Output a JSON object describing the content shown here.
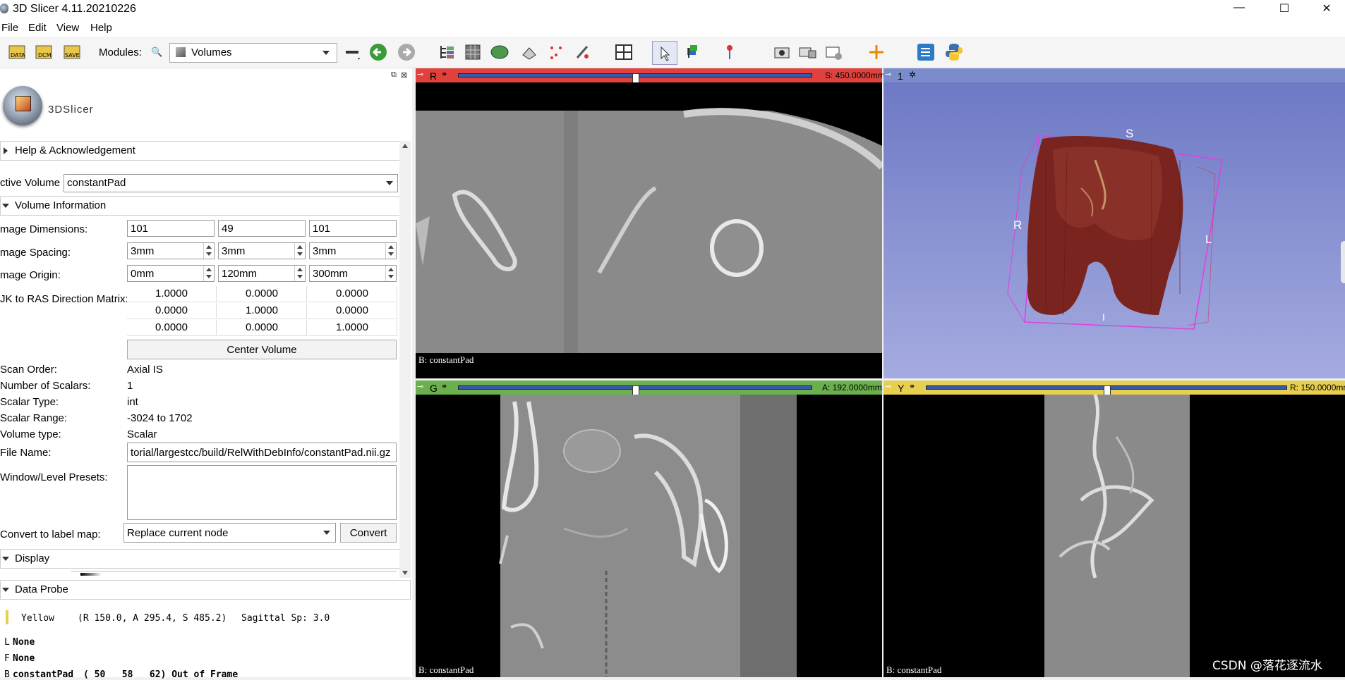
{
  "window": {
    "title": "3D Slicer 4.11.20210226",
    "minimize": "—",
    "maximize": "☐",
    "close": "✕"
  },
  "menu": [
    "File",
    "Edit",
    "View",
    "Help"
  ],
  "toolbar": {
    "modules_label": "Modules:",
    "module_selected": "Volumes",
    "data_label": "DATA",
    "dcm_label": "DCM",
    "save_label": "SAVE"
  },
  "logo_text": "3DSlicer",
  "help_section": "Help & Acknowledgement",
  "active_volume": {
    "label": "ctive Volume",
    "value": "constantPad"
  },
  "volume_info": {
    "title": "Volume Information",
    "dimensions": {
      "label": "mage Dimensions:",
      "values": [
        "101",
        "49",
        "101"
      ]
    },
    "spacing": {
      "label": "mage Spacing:",
      "values": [
        "3mm",
        "3mm",
        "3mm"
      ]
    },
    "origin": {
      "label": "mage Origin:",
      "values": [
        "0mm",
        "120mm",
        "300mm"
      ]
    },
    "matrix": {
      "label": "JK to RAS Direction Matrix:",
      "rows": [
        [
          "1.0000",
          "0.0000",
          "0.0000"
        ],
        [
          "0.0000",
          "1.0000",
          "0.0000"
        ],
        [
          "0.0000",
          "0.0000",
          "1.0000"
        ]
      ]
    },
    "center_button": "Center Volume",
    "scan_order": {
      "label": "Scan Order:",
      "value": "Axial IS"
    },
    "num_scalars": {
      "label": "Number of Scalars:",
      "value": "1"
    },
    "scalar_type": {
      "label": "Scalar Type:",
      "value": "int"
    },
    "scalar_range": {
      "label": "Scalar Range:",
      "value": "-3024 to 1702"
    },
    "volume_type": {
      "label": "Volume type:",
      "value": "Scalar"
    },
    "file_name": {
      "label": "File Name:",
      "value": "torial/largestcc/build/RelWithDebInfo/constantPad.nii.gz"
    },
    "wl_presets": {
      "label": "Window/Level Presets:"
    },
    "convert": {
      "label": "Convert to label map:",
      "option": "Replace current node",
      "button": "Convert"
    }
  },
  "display_section": "Display",
  "data_probe": {
    "title": "Data Probe",
    "view": "Yellow",
    "coords": "(R 150.0, A 295.4, S 485.2)",
    "orientation": "Sagittal Sp: 3.0",
    "rows": [
      {
        "key": "L",
        "value": "None",
        "extra": ""
      },
      {
        "key": "F",
        "value": "None",
        "extra": ""
      },
      {
        "key": "B",
        "value": "constantPad",
        "extra": "( 50   58   62) Out of Frame"
      }
    ]
  },
  "views": {
    "red": {
      "letter": "R",
      "offset": "S: 450.0000mm",
      "level": 0.5,
      "bg_label": "B: constantPad",
      "color": "#e0413c"
    },
    "threed": {
      "number": "1",
      "color": "#7a8ccc",
      "orient_s": "S",
      "orient_r": "R",
      "orient_l": "L",
      "orient_i": "I"
    },
    "green": {
      "letter": "G",
      "offset": "A: 192.0000mm",
      "level": 0.5,
      "bg_label": "B: constantPad",
      "color": "#6ab04c"
    },
    "yellow": {
      "letter": "Y",
      "offset": "R: 150.0000mm",
      "level": 0.5,
      "bg_label": "B: constantPad",
      "color": "#e7cf4f"
    }
  },
  "watermark": "CSDN @落花逐流水"
}
